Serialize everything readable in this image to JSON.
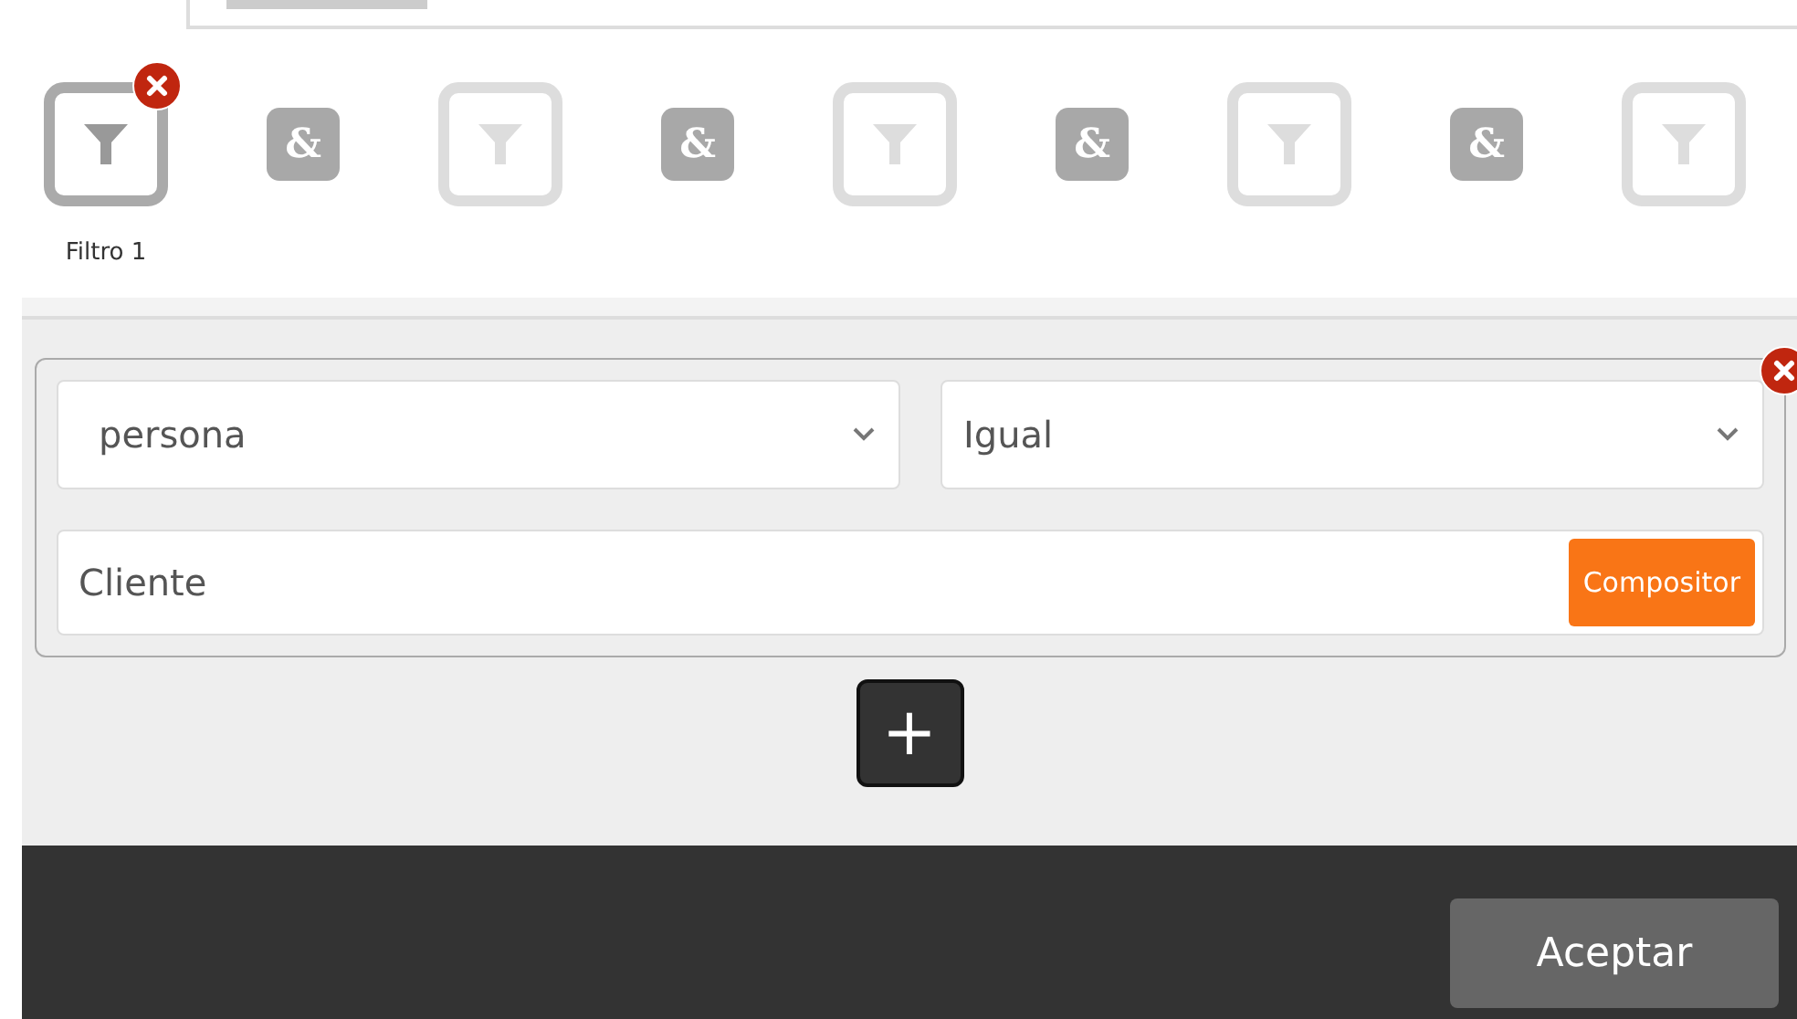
{
  "steps": [
    {
      "kind": "filter",
      "active": true,
      "removable": true,
      "label": "Filtro 1"
    },
    {
      "kind": "and",
      "symbol": "&"
    },
    {
      "kind": "filter",
      "active": false,
      "removable": false
    },
    {
      "kind": "and",
      "symbol": "&"
    },
    {
      "kind": "filter",
      "active": false,
      "removable": false
    },
    {
      "kind": "and",
      "symbol": "&"
    },
    {
      "kind": "filter",
      "active": false,
      "removable": false
    },
    {
      "kind": "and",
      "symbol": "&"
    },
    {
      "kind": "filter",
      "active": false,
      "removable": false
    }
  ],
  "condition": {
    "field": "persona",
    "operator": "Igual",
    "value": "Cliente",
    "composer_button": "Compositor"
  },
  "add_button": "+",
  "footer": {
    "accept_button": "Aceptar"
  }
}
